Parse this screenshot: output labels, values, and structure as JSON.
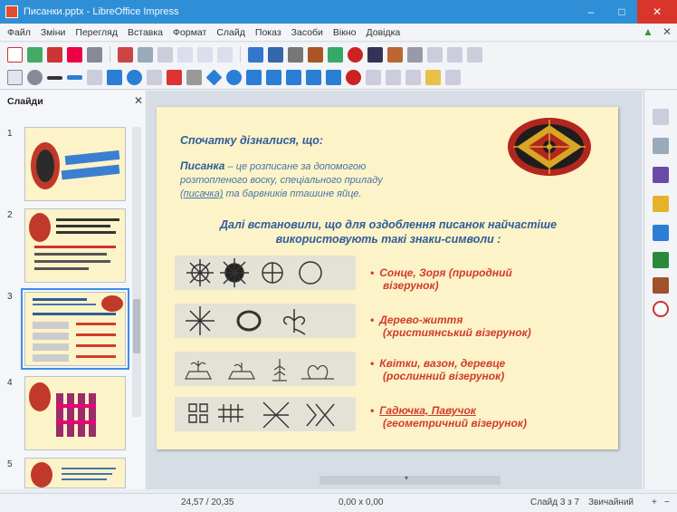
{
  "window": {
    "title": "Писанки.pptx - LibreOffice Impress"
  },
  "menubar": {
    "items": [
      "Файл",
      "Зміни",
      "Перегляд",
      "Вставка",
      "Формат",
      "Слайд",
      "Показ",
      "Засоби",
      "Вікно",
      "Довідка"
    ]
  },
  "slides_panel": {
    "title": "Слайди",
    "thumbnails": [
      "1",
      "2",
      "3",
      "4",
      "5"
    ]
  },
  "slide": {
    "heading": "Спочатку дізналися, що:",
    "definition_term": "Писанка",
    "definition_rest1": " – це розписане за допомогою",
    "definition_rest2": "розтопленого воску, спеціального приладу",
    "definition_tool": "(писачка)",
    "definition_rest3": "   та      барвників пташине яйце.",
    "paragraph2_line1": "Далі встановили, що для оздоблення писанок   найчастіше",
    "paragraph2_line2": "використовують  такі   знаки-символи :",
    "bullets": [
      {
        "line1": "Сонце, Зоря (природний",
        "line2": "візерунок)"
      },
      {
        "line1": "Дерево-життя",
        "line2": "(християнський візерунок)"
      },
      {
        "line1": "Квітки, вазон, деревце",
        "line2": "(рослинний візерунок)"
      },
      {
        "line1": "Гадючка, Павучок",
        "line2": "(геометричний візерунок)"
      }
    ]
  },
  "statusbar": {
    "position": "24,57 / 20,35",
    "size": "0,00 x 0,00",
    "slide_info": "Слайд 3 з 7",
    "layout": "Звичайний",
    "zoom_in": "+",
    "zoom_out": "−"
  },
  "colors": {
    "accent": "#2f8fd6",
    "slide_bg": "#fdf3c8",
    "heading": "#2e5d9a",
    "bullet": "#d23b2b"
  }
}
